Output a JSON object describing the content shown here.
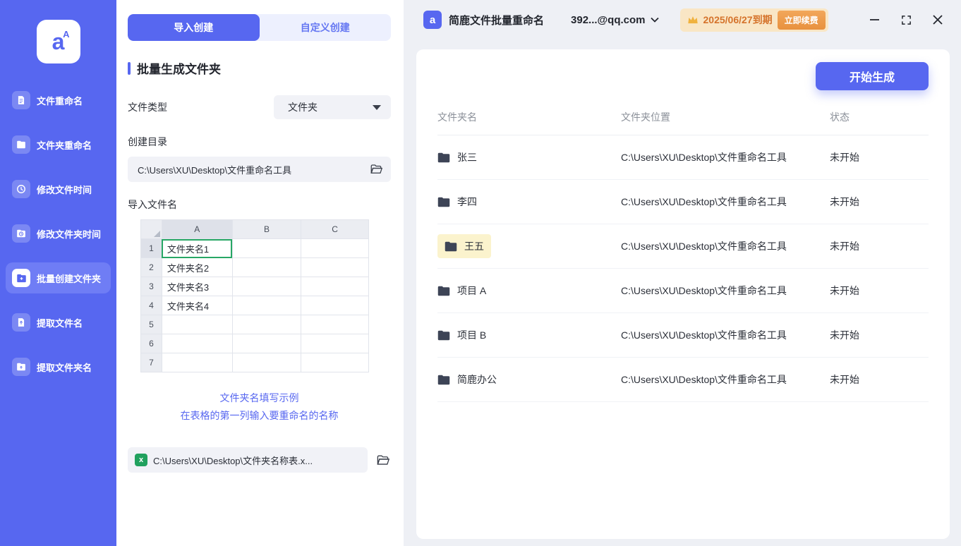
{
  "colors": {
    "accent": "#5767f0",
    "orange": "#e8913e",
    "excel_green": "#21a15e",
    "select_green": "#27a765"
  },
  "app": {
    "title": "简鹿文件批量重命名",
    "account": "392...@qq.com",
    "license": "2025/06/27到期",
    "renew_label": "立即续费"
  },
  "sidebar": {
    "items": [
      {
        "label": "文件重命名"
      },
      {
        "label": "文件夹重命名"
      },
      {
        "label": "修改文件时间"
      },
      {
        "label": "修改文件夹时间"
      },
      {
        "label": "批量创建文件夹",
        "active": true
      },
      {
        "label": "提取文件名"
      },
      {
        "label": "提取文件夹名"
      }
    ]
  },
  "panel": {
    "tabs": [
      {
        "label": "导入创建",
        "active": true
      },
      {
        "label": "自定义创建"
      }
    ],
    "section_title": "批量生成文件夹",
    "file_type_label": "文件类型",
    "file_type_value": "文件夹",
    "create_dir_label": "创建目录",
    "create_dir_value": "C:\\Users\\XU\\Desktop\\文件重命名工具",
    "import_label": "导入文件名",
    "sheet": {
      "columns": [
        "A",
        "B",
        "C"
      ],
      "rows": [
        {
          "n": "1",
          "a": "文件夹名1"
        },
        {
          "n": "2",
          "a": "文件夹名2"
        },
        {
          "n": "3",
          "a": "文件夹名3"
        },
        {
          "n": "4",
          "a": "文件夹名4"
        },
        {
          "n": "5",
          "a": ""
        },
        {
          "n": "6",
          "a": ""
        },
        {
          "n": "7",
          "a": ""
        }
      ]
    },
    "example_link": "文件夹名填写示例",
    "hint_link": "在表格的第一列输入要重命名的名称",
    "file_path": "C:\\Users\\XU\\Desktop\\文件夹名称表.x..."
  },
  "main": {
    "generate_button": "开始生成",
    "table": {
      "headers": [
        "文件夹名",
        "文件夹位置",
        "状态"
      ],
      "rows": [
        {
          "name": "张三",
          "location": "C:\\Users\\XU\\Desktop\\文件重命名工具",
          "status": "未开始"
        },
        {
          "name": "李四",
          "location": "C:\\Users\\XU\\Desktop\\文件重命名工具",
          "status": "未开始"
        },
        {
          "name": "王五",
          "location": "C:\\Users\\XU\\Desktop\\文件重命名工具",
          "status": "未开始",
          "highlight": true
        },
        {
          "name": "项目 A",
          "location": "C:\\Users\\XU\\Desktop\\文件重命名工具",
          "status": "未开始"
        },
        {
          "name": "项目 B",
          "location": "C:\\Users\\XU\\Desktop\\文件重命名工具",
          "status": "未开始"
        },
        {
          "name": "简鹿办公",
          "location": "C:\\Users\\XU\\Desktop\\文件重命名工具",
          "status": "未开始"
        }
      ]
    }
  }
}
